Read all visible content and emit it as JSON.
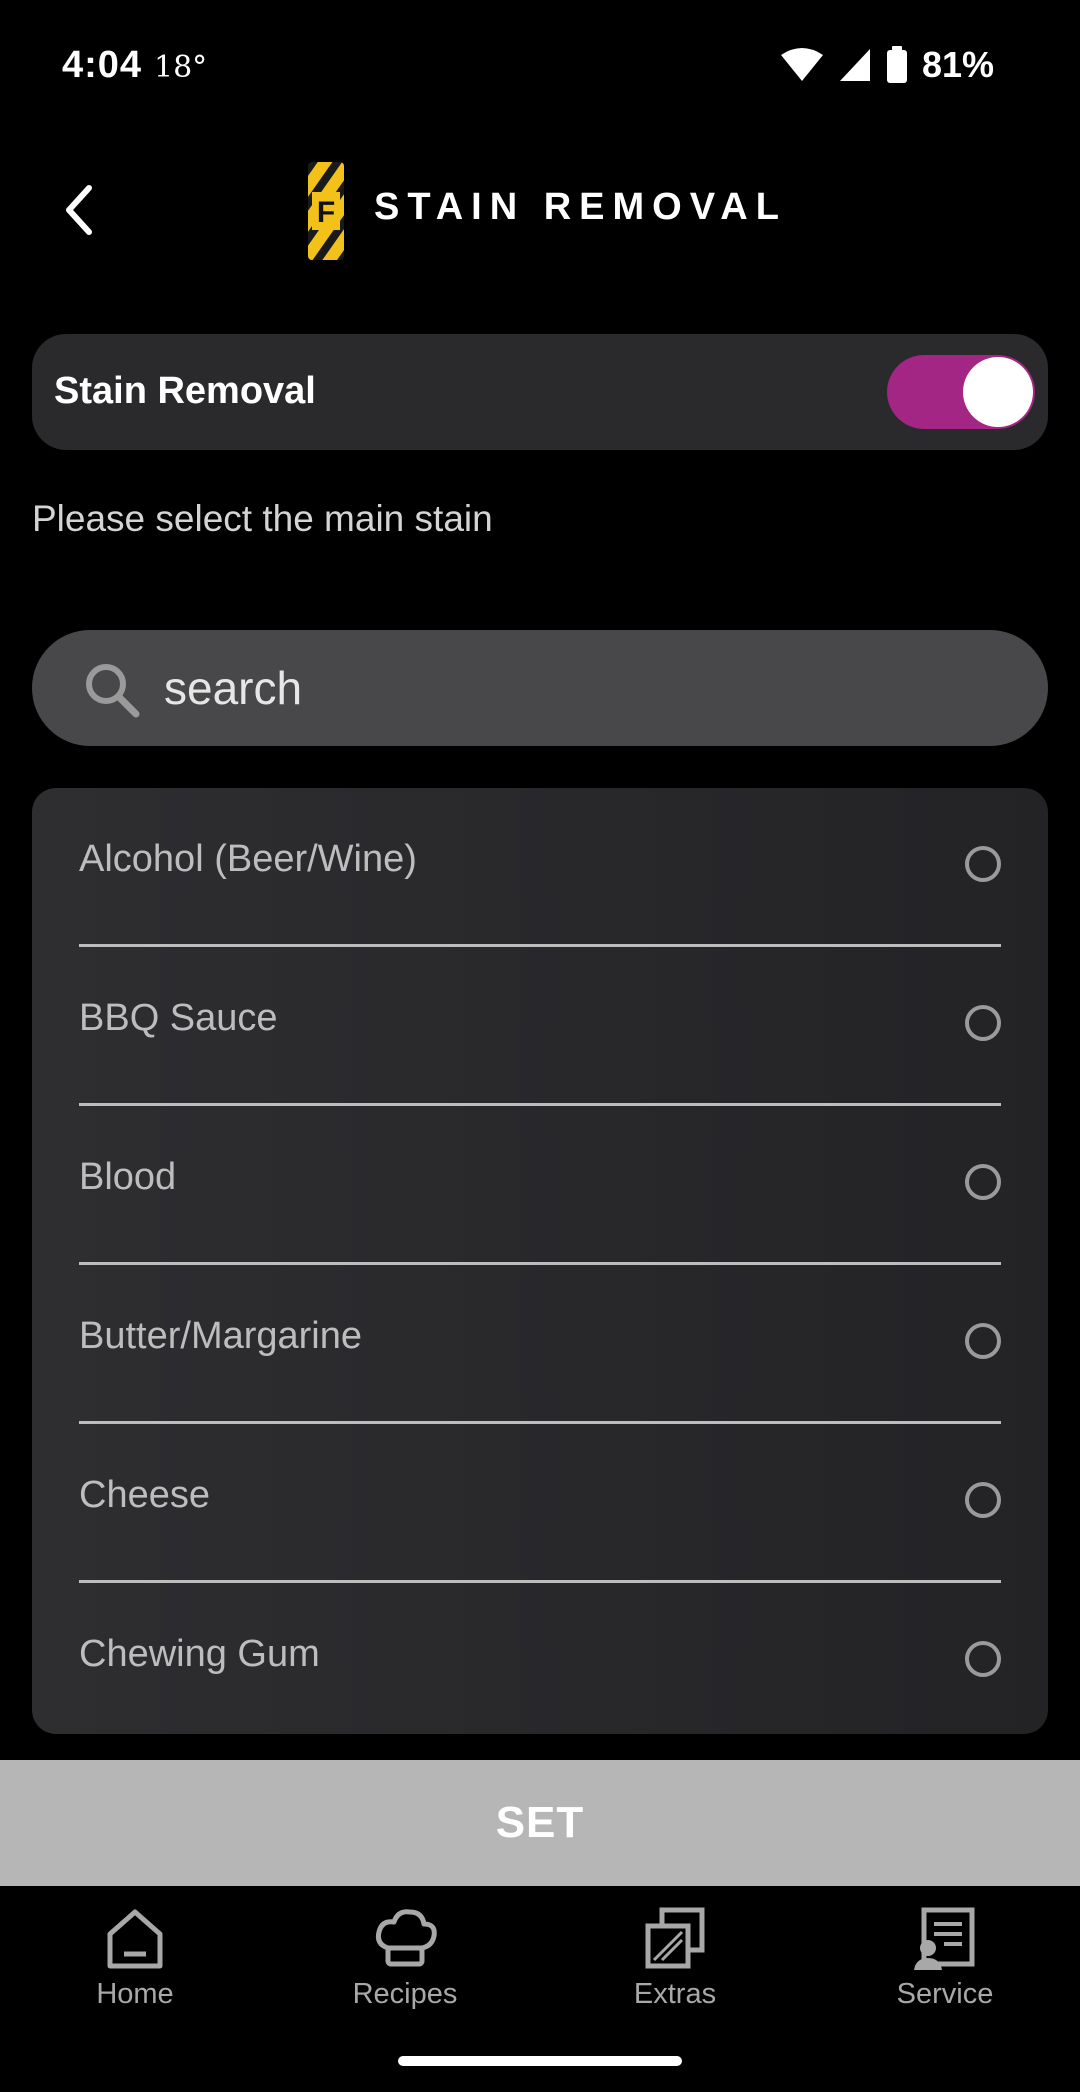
{
  "status_bar": {
    "time": "4:04",
    "temperature": "18°",
    "battery": "81%"
  },
  "header": {
    "title": "STAIN REMOVAL",
    "logo_letter": "F",
    "logo_color": "#f2c21b"
  },
  "toggle": {
    "label": "Stain Removal",
    "on": true,
    "color": "#a32584"
  },
  "instruction": "Please select the main stain",
  "search": {
    "placeholder": "search",
    "value": ""
  },
  "stains": [
    {
      "label": "Alcohol (Beer/Wine)",
      "selected": false
    },
    {
      "label": "BBQ Sauce",
      "selected": false
    },
    {
      "label": "Blood",
      "selected": false
    },
    {
      "label": "Butter/Margarine",
      "selected": false
    },
    {
      "label": "Cheese",
      "selected": false
    },
    {
      "label": "Chewing Gum",
      "selected": false
    }
  ],
  "set_button": "SET",
  "nav": [
    {
      "label": "Home",
      "icon": "home-icon"
    },
    {
      "label": "Recipes",
      "icon": "chef-hat-icon"
    },
    {
      "label": "Extras",
      "icon": "extras-icon"
    },
    {
      "label": "Service",
      "icon": "service-icon"
    }
  ]
}
